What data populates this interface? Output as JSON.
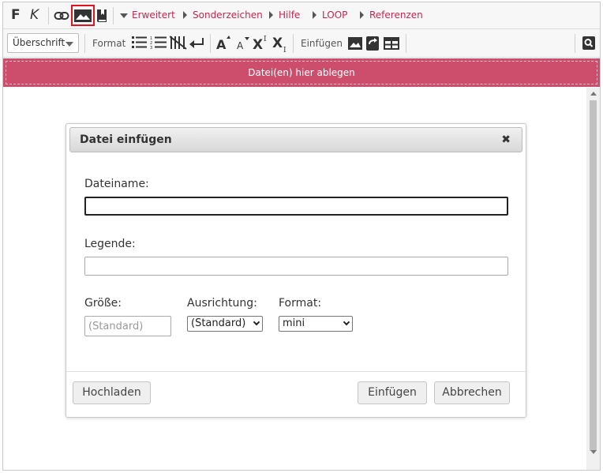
{
  "toolbar": {
    "bold_label": "F",
    "italic_label": "K",
    "menus": [
      "Erweitert",
      "Sonderzeichen",
      "Hilfe",
      "LOOP",
      "Referenzen"
    ],
    "heading_select": "Überschrift",
    "format_label": "Format",
    "insert_label": "Einfügen",
    "menu_color": "#c7254e",
    "highlight_color": "#e0141e"
  },
  "dropzone": {
    "label": "Datei(en) hier ablegen",
    "color": "#cc4d6c"
  },
  "dialog": {
    "title": "Datei einfügen",
    "close_symbol": "✖",
    "filename_label": "Dateiname:",
    "filename_value": "",
    "caption_label": "Legende:",
    "caption_value": "",
    "size_label": "Größe:",
    "size_placeholder": "(Standard)",
    "alignment_label": "Ausrichtung:",
    "alignment_value": "(Standard)",
    "format_label": "Format:",
    "format_value": "mini",
    "upload_button": "Hochladen",
    "insert_button": "Einfügen",
    "cancel_button": "Abbrechen"
  }
}
